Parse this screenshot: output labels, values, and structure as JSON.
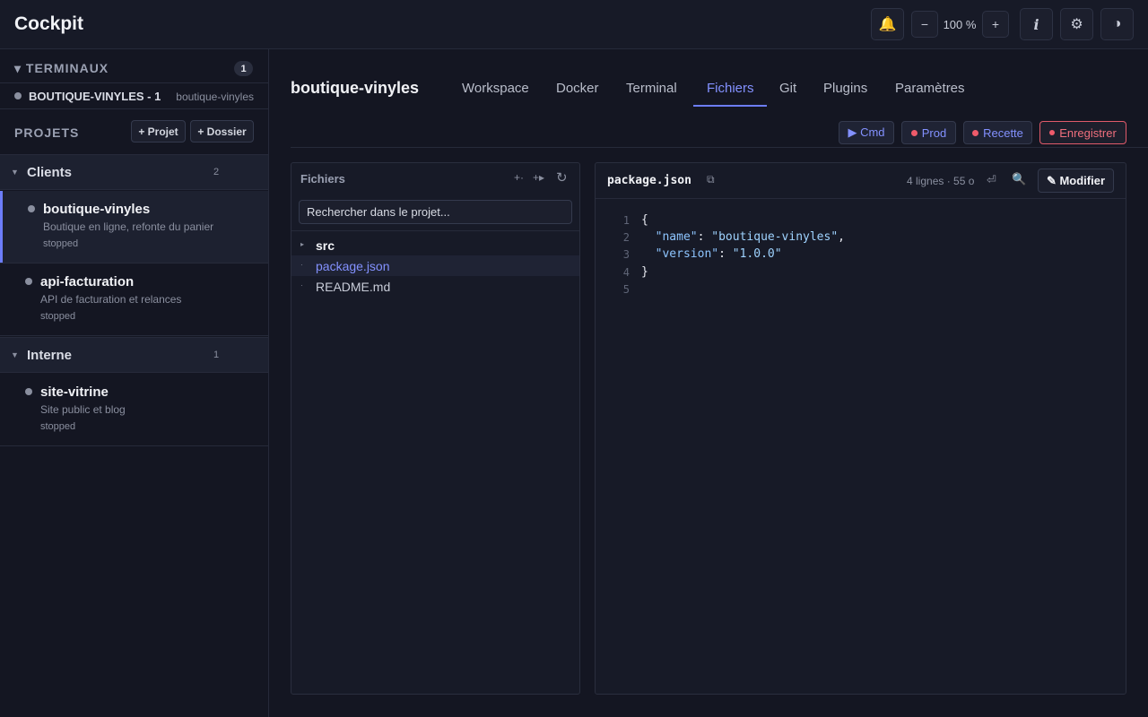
{
  "app": {
    "title": "Cockpit"
  },
  "topbar": {
    "bell_icon": "bell-icon",
    "zoom_out": "−",
    "zoom_level": "100 %",
    "zoom_in": "+",
    "info": "i",
    "settings": "⚙",
    "theme": "◑"
  },
  "sidebar": {
    "terminals": {
      "title": "▾ TERMINAUX",
      "count": "1",
      "items": [
        {
          "name": "BOUTIQUE-VINYLES - 1",
          "project": "boutique-vinyles"
        }
      ]
    },
    "projects": {
      "title": "PROJETS",
      "add_project": "+ Projet",
      "add_folder": "+ Dossier"
    },
    "groups": [
      {
        "name": "Clients",
        "count": "2",
        "projects": [
          {
            "name": "boutique-vinyles",
            "description": "Boutique en ligne, refonte du panier",
            "status": "stopped"
          },
          {
            "name": "api-facturation",
            "description": "API de facturation et relances",
            "status": "stopped"
          }
        ]
      },
      {
        "name": "Interne",
        "count": "1",
        "projects": [
          {
            "name": "site-vitrine",
            "description": "Site public et blog",
            "status": "stopped"
          }
        ]
      }
    ]
  },
  "main": {
    "project_title": "boutique-vinyles",
    "tabs": [
      {
        "label": "Workspace"
      },
      {
        "label": "Docker"
      },
      {
        "label": "Terminal"
      },
      {
        "label": "Fichiers"
      },
      {
        "label": "Git"
      },
      {
        "label": "Plugins"
      },
      {
        "label": "Paramètres"
      }
    ],
    "active_tab": "Fichiers",
    "actions": {
      "cmd": "▶ Cmd",
      "prod": "Prod",
      "recette": "Recette",
      "record": "Enregistrer"
    },
    "files": {
      "title": "Fichiers",
      "search_placeholder": "Rechercher dans le projet...",
      "tree": [
        {
          "name": "src",
          "type": "folder",
          "marker": "▸"
        },
        {
          "name": "package.json",
          "type": "file",
          "marker": "·"
        },
        {
          "name": "README.md",
          "type": "file",
          "marker": "·"
        }
      ],
      "selected": "package.json"
    },
    "editor": {
      "filename": "package.json",
      "meta": "4 lignes · 55 o",
      "edit_label": "✎ Modifier",
      "lines": [
        {
          "n": "1",
          "text": "{"
        },
        {
          "n": "2",
          "key": "\"name\"",
          "value": "\"boutique-vinyles\"",
          "trail": ","
        },
        {
          "n": "3",
          "key": "\"version\"",
          "value": "\"1.0.0\"",
          "trail": ""
        },
        {
          "n": "4",
          "text": "}"
        },
        {
          "n": "5",
          "text": ""
        }
      ]
    }
  },
  "colors": {
    "accent": "#6c7dfa",
    "danger": "#ef5b6b",
    "background": "#141622"
  }
}
